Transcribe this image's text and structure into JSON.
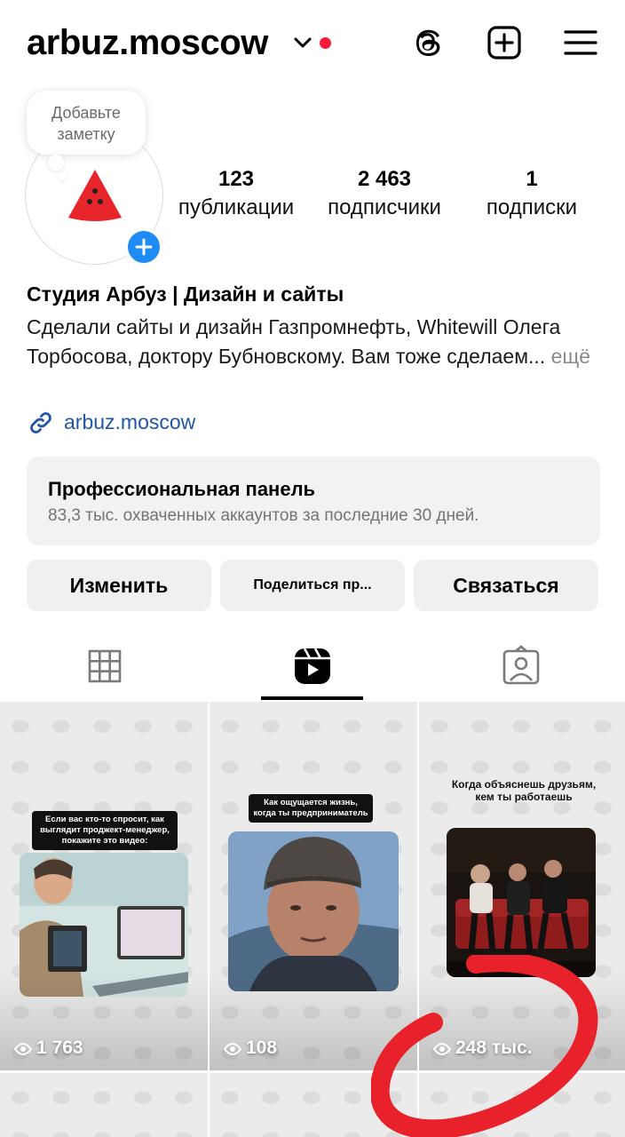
{
  "header": {
    "username": "arbuz.moscow",
    "icons": [
      "chevron-down-icon",
      "threads-icon",
      "add-post-icon",
      "menu-icon"
    ]
  },
  "note": {
    "line1": "Добавьте",
    "line2": "заметку"
  },
  "stats": [
    {
      "num": "123",
      "label": "публикации"
    },
    {
      "num": "2 463",
      "label": "подписчики"
    },
    {
      "num": "1",
      "label": "подписки"
    }
  ],
  "profile": {
    "name": "Студия Арбуз | Дизайн и сайты",
    "bio": "Сделали сайты и дизайн Газпромнефть, Whitewill Олега Торбосова, доктору Бубновскому. Вам тоже сделаем...",
    "more": " ещё",
    "link": "arbuz.moscow"
  },
  "pro_panel": {
    "title": "Профессиональная панель",
    "subtitle": "83,3 тыс. охваченных аккаунтов за последние 30 дней."
  },
  "buttons": {
    "edit": "Изменить",
    "share": "Поделиться пр...",
    "contact": "Связаться"
  },
  "tabs": [
    "grid-icon",
    "reels-icon",
    "tagged-icon"
  ],
  "reels": [
    {
      "caption": "Если вас кто-то спросит, как выглядит проджект-менеджер, покажите это видео:",
      "views": "1 763"
    },
    {
      "caption": "Как ощущается жизнь, когда ты предприниматель",
      "views": "108"
    },
    {
      "caption": "Когда объяснешь друзьям, кем ты работаешь",
      "views": "248 тыс."
    }
  ],
  "colors": {
    "accent_blue": "#1e8cf4",
    "link": "#1e56a8",
    "notification_red": "#ff1a3a",
    "annotation_red": "#e8212b"
  }
}
